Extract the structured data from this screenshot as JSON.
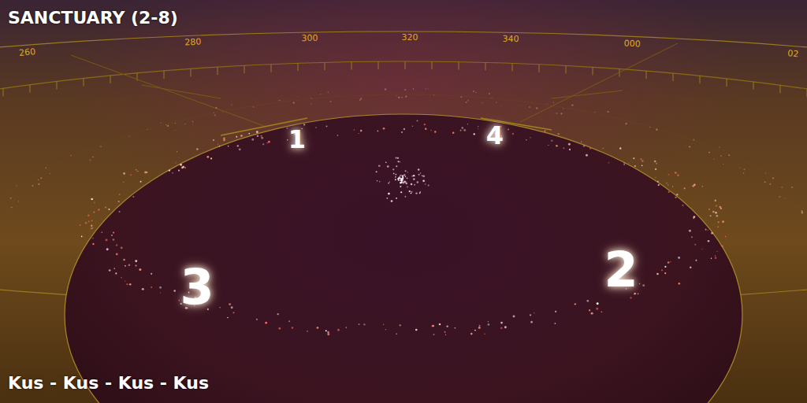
{
  "map": {
    "title": "SANCTUARY (2-8)",
    "compass_labels": [
      "260",
      "280",
      "300",
      "320",
      "340",
      "000",
      "02"
    ],
    "start_positions": [
      {
        "label": "1"
      },
      {
        "label": "2"
      },
      {
        "label": "3"
      },
      {
        "label": "4"
      }
    ]
  },
  "players": "Kus - Kus - Kus - Kus"
}
